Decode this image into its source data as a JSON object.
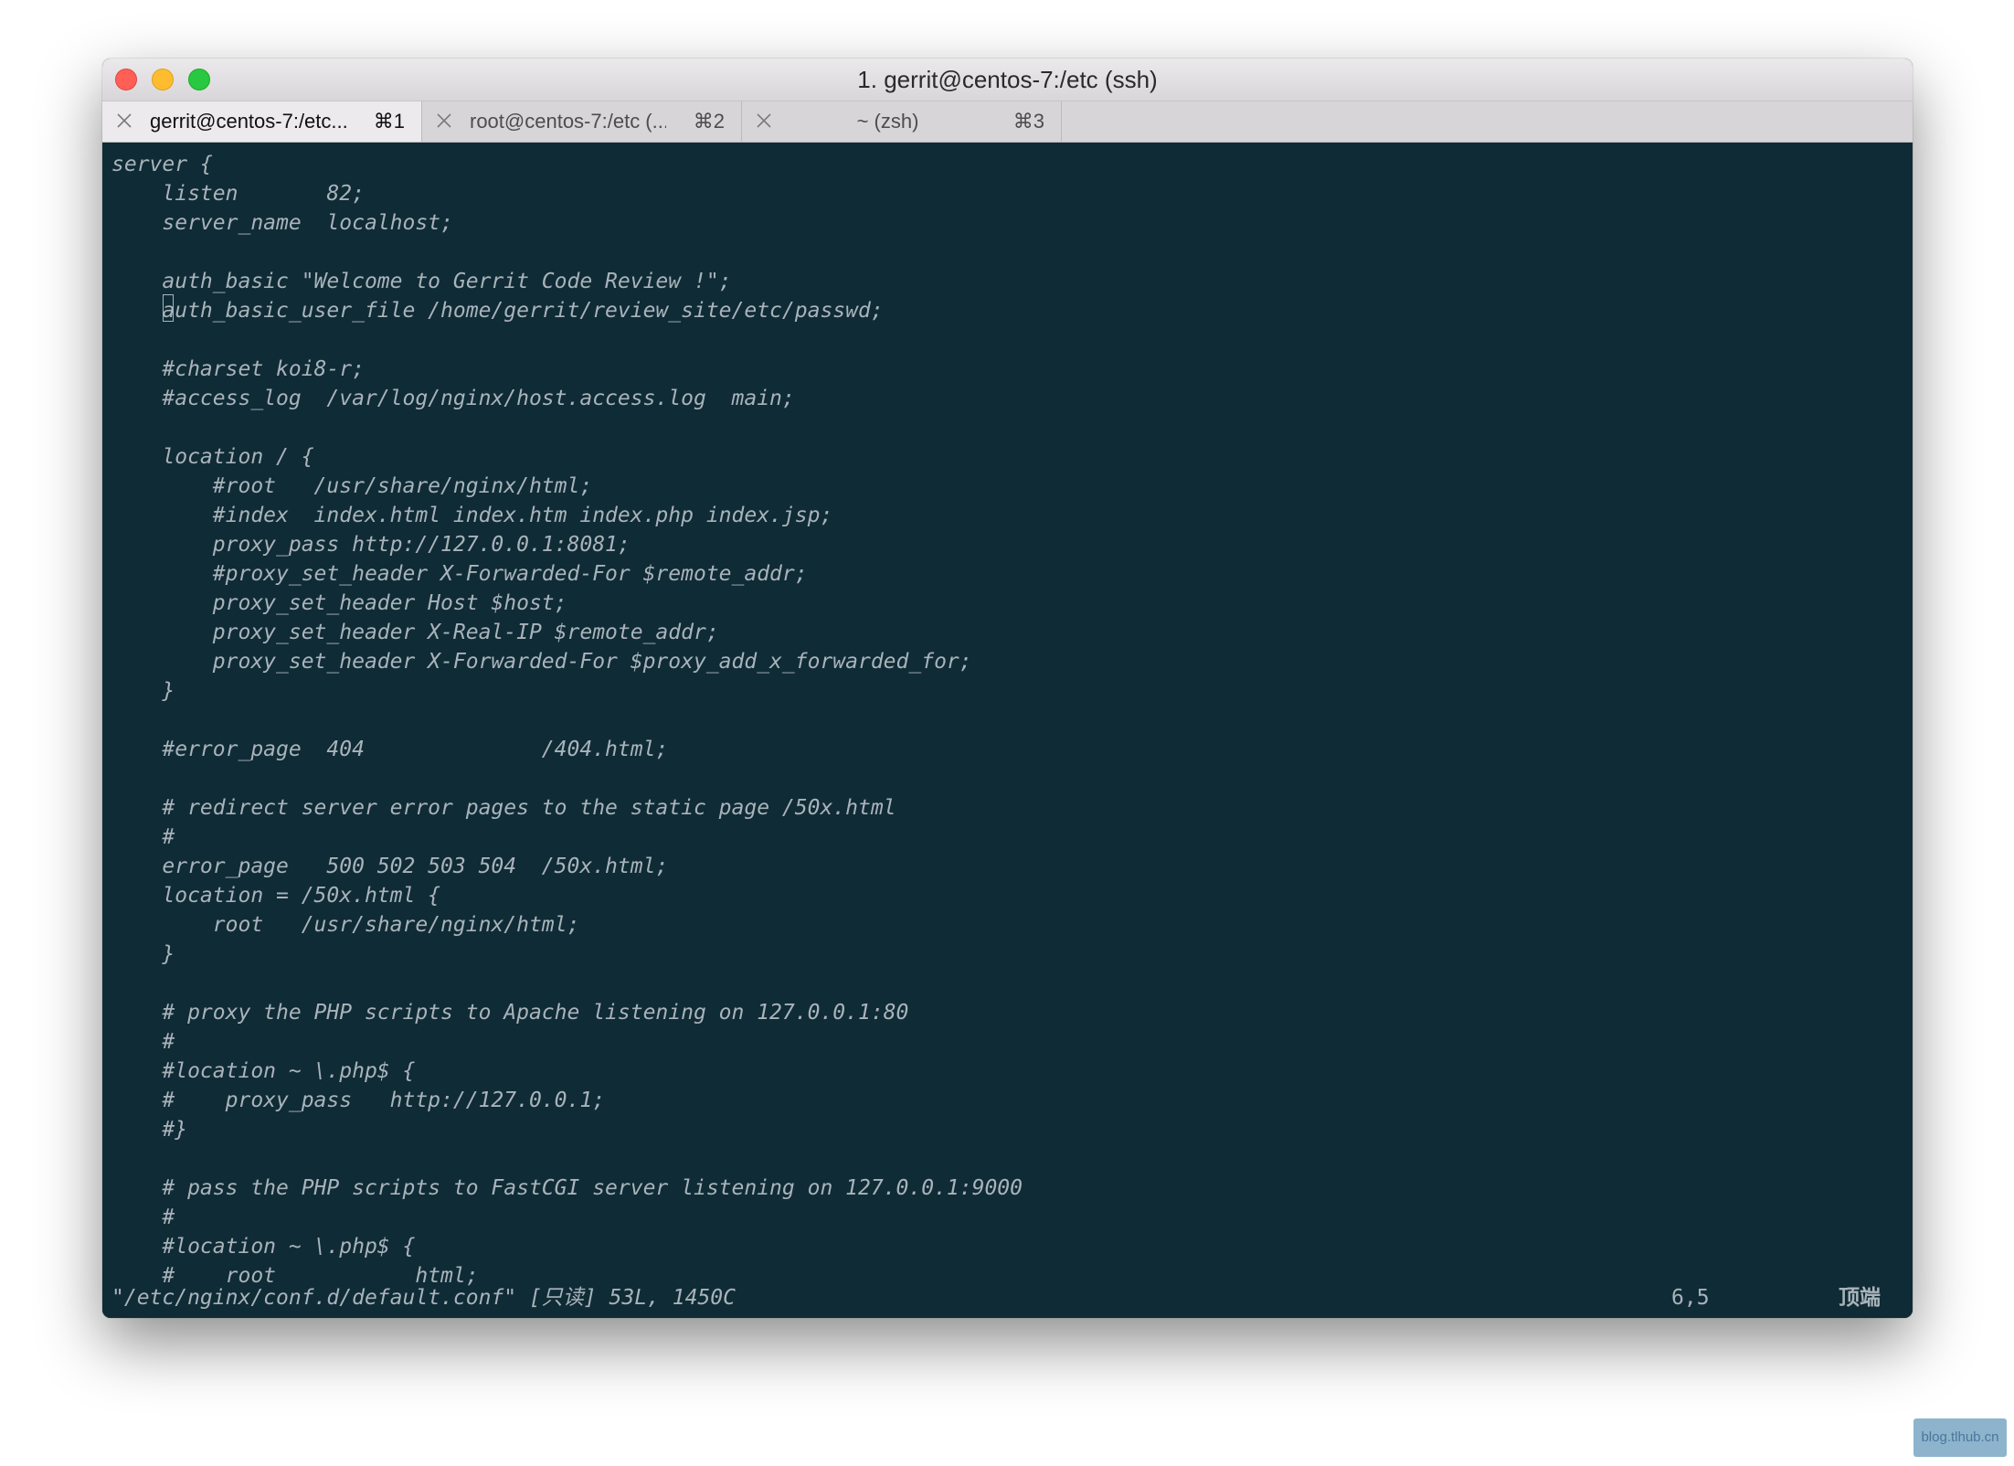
{
  "window": {
    "title": "1. gerrit@centos-7:/etc (ssh)"
  },
  "tabs": [
    {
      "label": "gerrit@centos-7:/etc...",
      "shortcut": "⌘1",
      "active": true,
      "close_icon": "close-icon"
    },
    {
      "label": "root@centos-7:/etc (...",
      "shortcut": "⌘2",
      "active": false,
      "close_icon": "close-icon"
    },
    {
      "label": "~ (zsh)",
      "shortcut": "⌘3",
      "active": false,
      "close_icon": "close-icon"
    }
  ],
  "editor": {
    "lines": [
      "server {",
      "    listen       82;",
      "    server_name  localhost;",
      "",
      "    auth_basic \"Welcome to Gerrit Code Review !\";",
      "    auth_basic_user_file /home/gerrit/review_site/etc/passwd;",
      "",
      "    #charset koi8-r;",
      "    #access_log  /var/log/nginx/host.access.log  main;",
      "",
      "    location / {",
      "        #root   /usr/share/nginx/html;",
      "        #index  index.html index.htm index.php index.jsp;",
      "        proxy_pass http://127.0.0.1:8081;",
      "        #proxy_set_header X-Forwarded-For $remote_addr;",
      "        proxy_set_header Host $host;",
      "        proxy_set_header X-Real-IP $remote_addr;",
      "        proxy_set_header X-Forwarded-For $proxy_add_x_forwarded_for;",
      "    }",
      "",
      "    #error_page  404              /404.html;",
      "",
      "    # redirect server error pages to the static page /50x.html",
      "    #",
      "    error_page   500 502 503 504  /50x.html;",
      "    location = /50x.html {",
      "        root   /usr/share/nginx/html;",
      "    }",
      "",
      "    # proxy the PHP scripts to Apache listening on 127.0.0.1:80",
      "    #",
      "    #location ~ \\.php$ {",
      "    #    proxy_pass   http://127.0.0.1;",
      "    #}",
      "",
      "    # pass the PHP scripts to FastCGI server listening on 127.0.0.1:9000",
      "    #",
      "    #location ~ \\.php$ {",
      "    #    root           html;"
    ],
    "status": {
      "file_info": "\"/etc/nginx/conf.d/default.conf\" [只读] 53L, 1450C",
      "cursor_position": "6,5",
      "scroll_position": "顶端"
    }
  },
  "watermark": {
    "text": "blog.tlhub.cn"
  },
  "colors": {
    "terminal_bg": "#0f2b36",
    "terminal_fg": "#a9b3ba",
    "close": "#ff5f57",
    "minimize": "#febc2e",
    "maximize": "#28c840"
  }
}
